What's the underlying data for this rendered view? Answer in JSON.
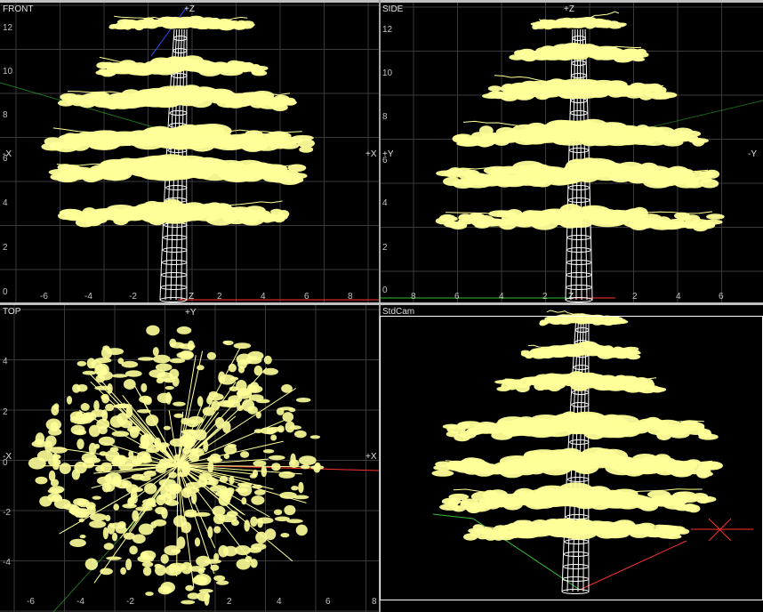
{
  "viewports": {
    "front": {
      "title": "FRONT",
      "axis_top": "+Z",
      "axis_left": "-X",
      "axis_right": "+X",
      "axis_bottom": "Z",
      "y_ticks": [
        "12",
        "10",
        "8",
        "6",
        "4",
        "2",
        "0"
      ],
      "x_ticks": [
        "-6",
        "-4",
        "-2",
        "2",
        "4",
        "6",
        "8"
      ]
    },
    "side": {
      "title": "SIDE",
      "axis_top": "+Z",
      "axis_left": "+Y",
      "axis_right": "-Y",
      "axis_bottom": "Z",
      "y_ticks": [
        "12",
        "10",
        "8",
        "6",
        "4",
        "2",
        "0"
      ],
      "x_ticks": [
        "8",
        "6",
        "4",
        "2",
        "2",
        "4",
        "6"
      ]
    },
    "top": {
      "title": "TOP",
      "axis_top": "+Y",
      "axis_left": "-X",
      "axis_right": "+X",
      "y_ticks": [
        "4",
        "2",
        "0",
        "-2",
        "-4"
      ],
      "x_ticks": [
        "-6",
        "-4",
        "-2",
        "2",
        "4",
        "6",
        "8"
      ]
    },
    "cam": {
      "title": "StdCam"
    }
  },
  "colors": {
    "viewport_bg": "#000000",
    "grid": "#3a3a3a",
    "foliage": "#ffff99",
    "trunk": "#ffffff",
    "axis_x": "#ff3030",
    "axis_y": "#30c030",
    "axis_z": "#3050ff",
    "frame": "#c0c0c0"
  },
  "icons": {
    "grid": "viewport-grid",
    "tree": "tree-wireframe-icon",
    "gizmo": "axis-gizmo-icon"
  }
}
